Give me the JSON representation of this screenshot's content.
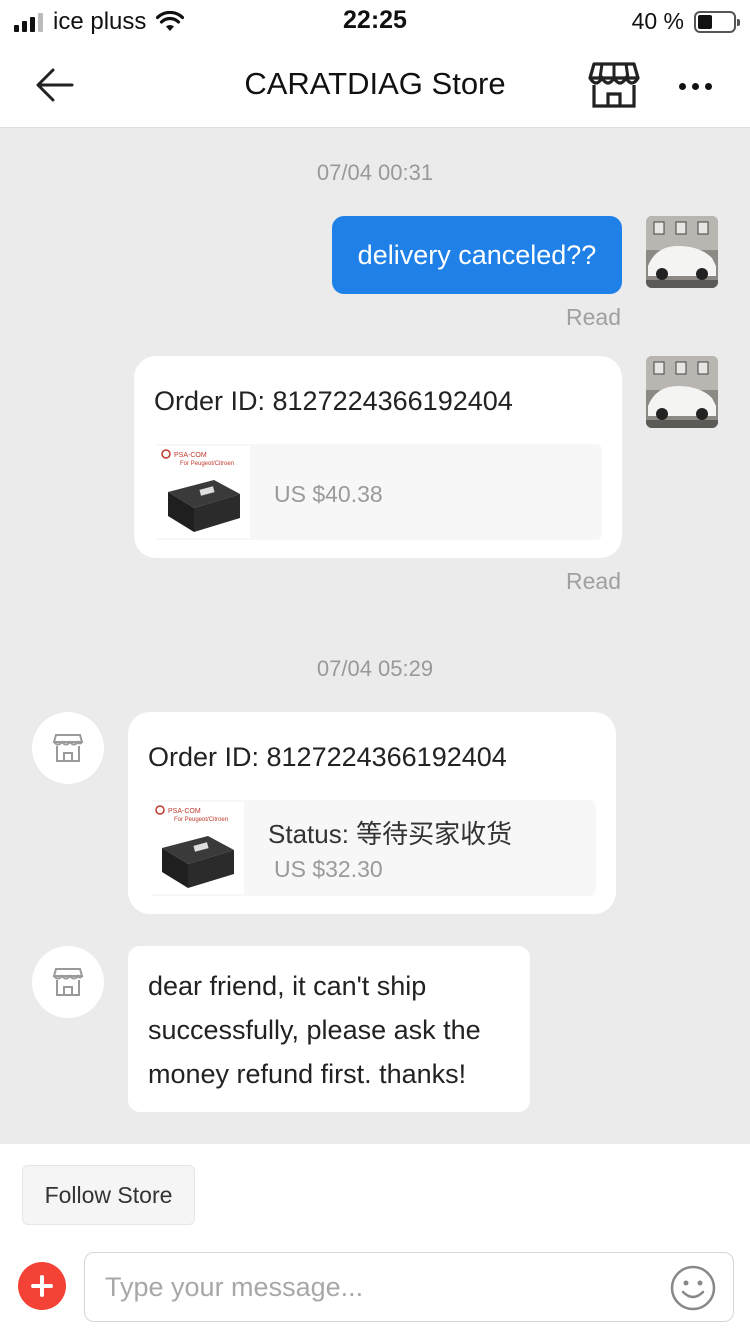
{
  "status_bar": {
    "carrier": "ice pluss",
    "time": "22:25",
    "battery": "40 %",
    "battery_level": 0.4
  },
  "header": {
    "title": "CARATDIAG Store",
    "icons": [
      "back-arrow-icon",
      "store-icon",
      "more-icon"
    ]
  },
  "chat": {
    "timestamp_1": "07/04 00:31",
    "msg_1_text": "delivery canceled??",
    "msg_1_status": "Read",
    "order_1": {
      "label": "Order ID: 8127224366192404",
      "product_title": "PSA-COM",
      "product_subtitle": "For Peugeot/Citroen",
      "price": "US $40.38",
      "status": "Read"
    },
    "timestamp_2": "07/04 05:29",
    "order_2": {
      "label": "Order ID: 8127224366192404",
      "product_title": "PSA-COM",
      "product_subtitle": "For Peugeot/Citroen",
      "status": "Status:  等待买家收货",
      "price": "US $32.30"
    },
    "msg_2_lines": [
      "dear friend, it can't ship",
      "successfully, please ask the",
      "money refund first. thanks!"
    ]
  },
  "bottom": {
    "follow_label": "Follow Store",
    "input_placeholder": "Type your message...",
    "accent_color": "#f44336",
    "bubble_color": "#1f80e8"
  }
}
